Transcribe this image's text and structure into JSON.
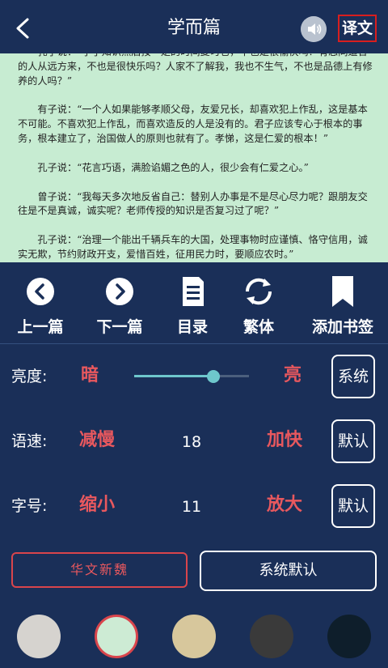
{
  "header": {
    "title": "学而篇",
    "translate_label": "译文",
    "icons": {
      "back": "chevron-left-icon",
      "speaker": "speaker-icon"
    }
  },
  "reader": {
    "paragraphs": [
      "孔子说：“学了知识然后按一定的时间复习它，不也是很愉快吗？有志同道合的人从远方来，不也是很快乐吗？人家不了解我，我也不生气，不也是品德上有修养的人吗？”",
      "有子说：“一个人如果能够孝顺父母，友爱兄长，却喜欢犯上作乱，这是基本不可能。不喜欢犯上作乱，而喜欢造反的人是没有的。君子应该专心于根本的事务，根本建立了，治国做人的原则也就有了。孝悌，这是仁爱的根本！”",
      "孔子说：“花言巧语，满脸谄媚之色的人，很少会有仁爱之心。”",
      "曾子说：“我每天多次地反省自己：替别人办事是不是尽心尽力呢？跟朋友交往是不是真诚，诚实呢？老师传授的知识是否复习过了呢？”",
      "孔子说：“治理一个能出千辆兵车的大国，处理事物时应谨慎、恪守信用，诚实无欺，节约财政开支，爱惜百姓，征用民力时，要顺应农时。”"
    ]
  },
  "actions": [
    {
      "label": "上一篇",
      "icon": "previous-circle-icon"
    },
    {
      "label": "下一篇",
      "icon": "next-circle-icon"
    },
    {
      "label": "目录",
      "icon": "document-list-icon"
    },
    {
      "label": "繁体",
      "icon": "refresh-icon"
    },
    {
      "label": "添加书签",
      "icon": "bookmark-icon"
    }
  ],
  "settings": {
    "brightness": {
      "label": "亮度:",
      "dark": "暗",
      "bright": "亮",
      "level": 0.7,
      "button": "系统"
    },
    "speed": {
      "label": "语速:",
      "slower": "减慢",
      "value": "18",
      "faster": "加快",
      "button": "默认"
    },
    "fontsize": {
      "label": "字号:",
      "smaller": "缩小",
      "value": "11",
      "bigger": "放大",
      "button": "默认"
    },
    "font_button": "华文新魏",
    "system_default": "系统默认"
  },
  "themes": {
    "colors": [
      "#d6d3cf",
      "#cdebd4",
      "#d7c79c",
      "#3a3a3a",
      "#0e1e2b"
    ],
    "selected_index": 1,
    "selected_ring": "#d9454c"
  },
  "colors": {
    "accent_red": "#e8585e",
    "background": "#1a2f58",
    "reader_bg": "#c7ecd2",
    "slider": "#6ec7cc"
  }
}
